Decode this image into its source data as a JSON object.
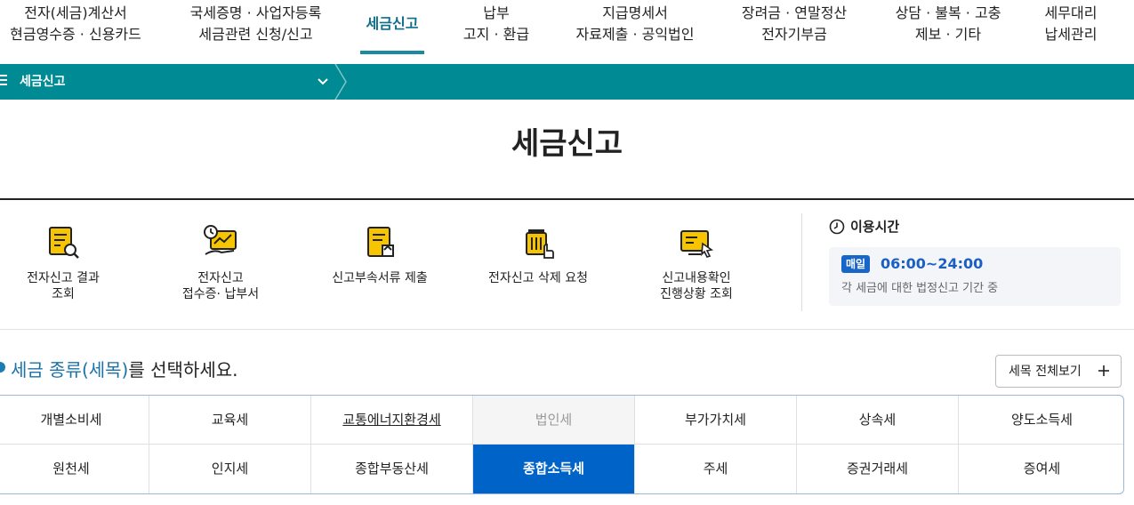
{
  "nav": {
    "items": [
      {
        "line1": "전자(세금)계산서",
        "line2": "현금영수증 · 신용카드"
      },
      {
        "line1": "국세증명 · 사업자등록",
        "line2": "세금관련 신청/신고"
      },
      {
        "line1": "세금신고",
        "line2": ""
      },
      {
        "line1": "납부",
        "line2": "고지 · 환급"
      },
      {
        "line1": "지급명세서",
        "line2": "자료제출 · 공익법인"
      },
      {
        "line1": "장려금 · 연말정산",
        "line2": "전자기부금"
      },
      {
        "line1": "상담 · 불복 · 고충",
        "line2": "제보 · 기타"
      },
      {
        "line1": "세무대리",
        "line2": "납세관리"
      }
    ],
    "active_color": "#0f6e8c"
  },
  "breadcrumb": {
    "label": "세금신고",
    "band_color": "#008a93"
  },
  "page": {
    "title": "세금신고"
  },
  "services": [
    {
      "icon": "document-search-icon",
      "line1": "전자신고 결과",
      "line2": "조회"
    },
    {
      "icon": "clock-chart-hand-icon",
      "line1": "전자신고",
      "line2": "접수증· 납부서"
    },
    {
      "icon": "document-upload-icon",
      "line1": "신고부속서류 제출",
      "line2": ""
    },
    {
      "icon": "trash-hand-icon",
      "line1": "전자신고 삭제 요청",
      "line2": ""
    },
    {
      "icon": "monitor-check-icon",
      "line1": "신고내용확인",
      "line2": "진행상황 조회"
    }
  ],
  "usage": {
    "title": "이용시간",
    "badge": "매일",
    "hours": "06:00~24:00",
    "note": "각 세금에 대한 법정신고 기간 중",
    "badge_color": "#1866c8"
  },
  "tax_section": {
    "heading_highlight": "세금 종류(세목)",
    "heading_rest": "를 선택하세요.",
    "view_all": "세목 전체보기",
    "rows": [
      [
        "개별소비세",
        "교육세",
        "교통에너지환경세",
        "법인세",
        "부가가치세",
        "상속세",
        "양도소득세"
      ],
      [
        "원천세",
        "인지세",
        "종합부동산세",
        "종합소득세",
        "주세",
        "증권거래세",
        "증여세"
      ]
    ],
    "selected": "종합소득세",
    "disabled": "법인세",
    "underlined": "교통에너지환경세",
    "selected_color": "#0063c7"
  }
}
